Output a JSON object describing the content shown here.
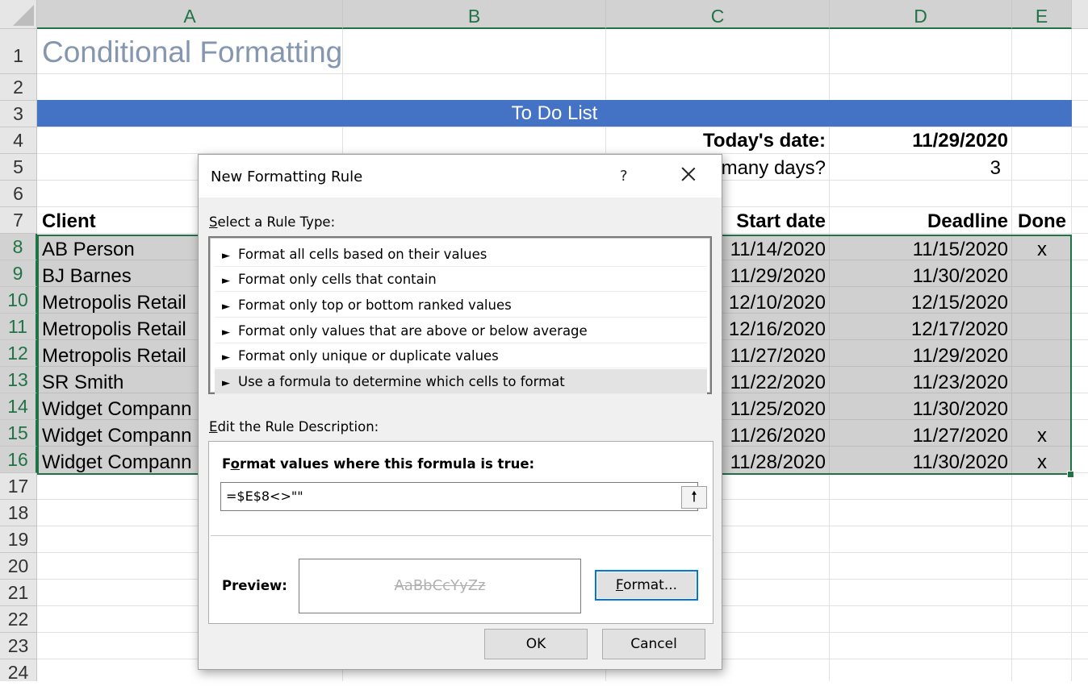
{
  "columns": [
    "A",
    "B",
    "C",
    "D",
    "E"
  ],
  "rows": [
    "1",
    "2",
    "3",
    "4",
    "5",
    "6",
    "7",
    "8",
    "9",
    "10",
    "11",
    "12",
    "13",
    "14",
    "15",
    "16",
    "17",
    "18",
    "19",
    "20",
    "21",
    "22",
    "23",
    "24"
  ],
  "sheet": {
    "title": "Conditional Formatting",
    "banner": "To Do List",
    "today_label": "Today's date:",
    "today_value": "11/29/2020",
    "days_label": "many days?",
    "days_value": "3",
    "headers": {
      "client": "Client",
      "start": "Start date",
      "deadline": "Deadline",
      "done": "Done"
    },
    "data_rows": [
      {
        "client": "AB Person",
        "start": "11/14/2020",
        "deadline": "11/15/2020",
        "done": "x"
      },
      {
        "client": "BJ Barnes",
        "start": "11/29/2020",
        "deadline": "11/30/2020",
        "done": ""
      },
      {
        "client": "Metropolis Retail",
        "start": "12/10/2020",
        "deadline": "12/15/2020",
        "done": ""
      },
      {
        "client": "Metropolis Retail",
        "start": "12/16/2020",
        "deadline": "12/17/2020",
        "done": ""
      },
      {
        "client": "Metropolis Retail",
        "start": "11/27/2020",
        "deadline": "11/29/2020",
        "done": ""
      },
      {
        "client": "SR Smith",
        "start": "11/22/2020",
        "deadline": "11/23/2020",
        "done": ""
      },
      {
        "client": "Widget Compann",
        "start": "11/25/2020",
        "deadline": "11/30/2020",
        "done": ""
      },
      {
        "client": "Widget Compann",
        "start": "11/26/2020",
        "deadline": "11/27/2020",
        "done": "x"
      },
      {
        "client": "Widget Compann",
        "start": "11/28/2020",
        "deadline": "11/30/2020",
        "done": "x"
      }
    ]
  },
  "dialog": {
    "title": "New Formatting Rule",
    "help": "?",
    "select_label_key": "S",
    "select_label_rest": "elect a Rule Type:",
    "rule_types": [
      "Format all cells based on their values",
      "Format only cells that contain",
      "Format only top or bottom ranked values",
      "Format only values that are above or below average",
      "Format only unique or duplicate values",
      "Use a formula to determine which cells to format"
    ],
    "selected_rule_index": 5,
    "edit_label_key": "E",
    "edit_label_rest": "dit the Rule Description:",
    "formula_label_pre": "F",
    "formula_label_key": "o",
    "formula_label_rest": "rmat values where this formula is true:",
    "formula_value": "=$E$8<>\"\"",
    "preview_label": "Preview:",
    "preview_text": "AaBbCcYyZz",
    "format_button_key": "F",
    "format_button_rest": "ormat...",
    "ok_label": "OK",
    "cancel_label": "Cancel"
  }
}
